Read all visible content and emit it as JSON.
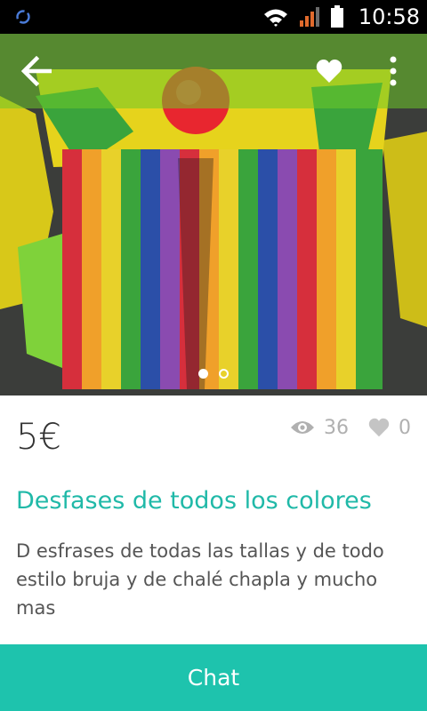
{
  "status_bar": {
    "time": "10:58",
    "icons": [
      "sync-icon",
      "wifi-icon",
      "signal-icon",
      "battery-icon"
    ]
  },
  "toolbar": {
    "back_icon": "arrow-back-icon",
    "favorite_icon": "heart-icon",
    "more_icon": "more-vertical-icon"
  },
  "gallery": {
    "page_count": 2,
    "current_page": 1
  },
  "listing": {
    "price": "5€",
    "views": "36",
    "likes": "0",
    "title": "Desfases de todos los colores",
    "description": "D esfrases de todas las tallas y de todo estilo bruja y de chalé chapla y mucho mas"
  },
  "actions": {
    "chat_label": "Chat"
  },
  "colors": {
    "accent": "#1ec3ad",
    "title": "#20b9a8",
    "muted": "#b0b0b0"
  }
}
